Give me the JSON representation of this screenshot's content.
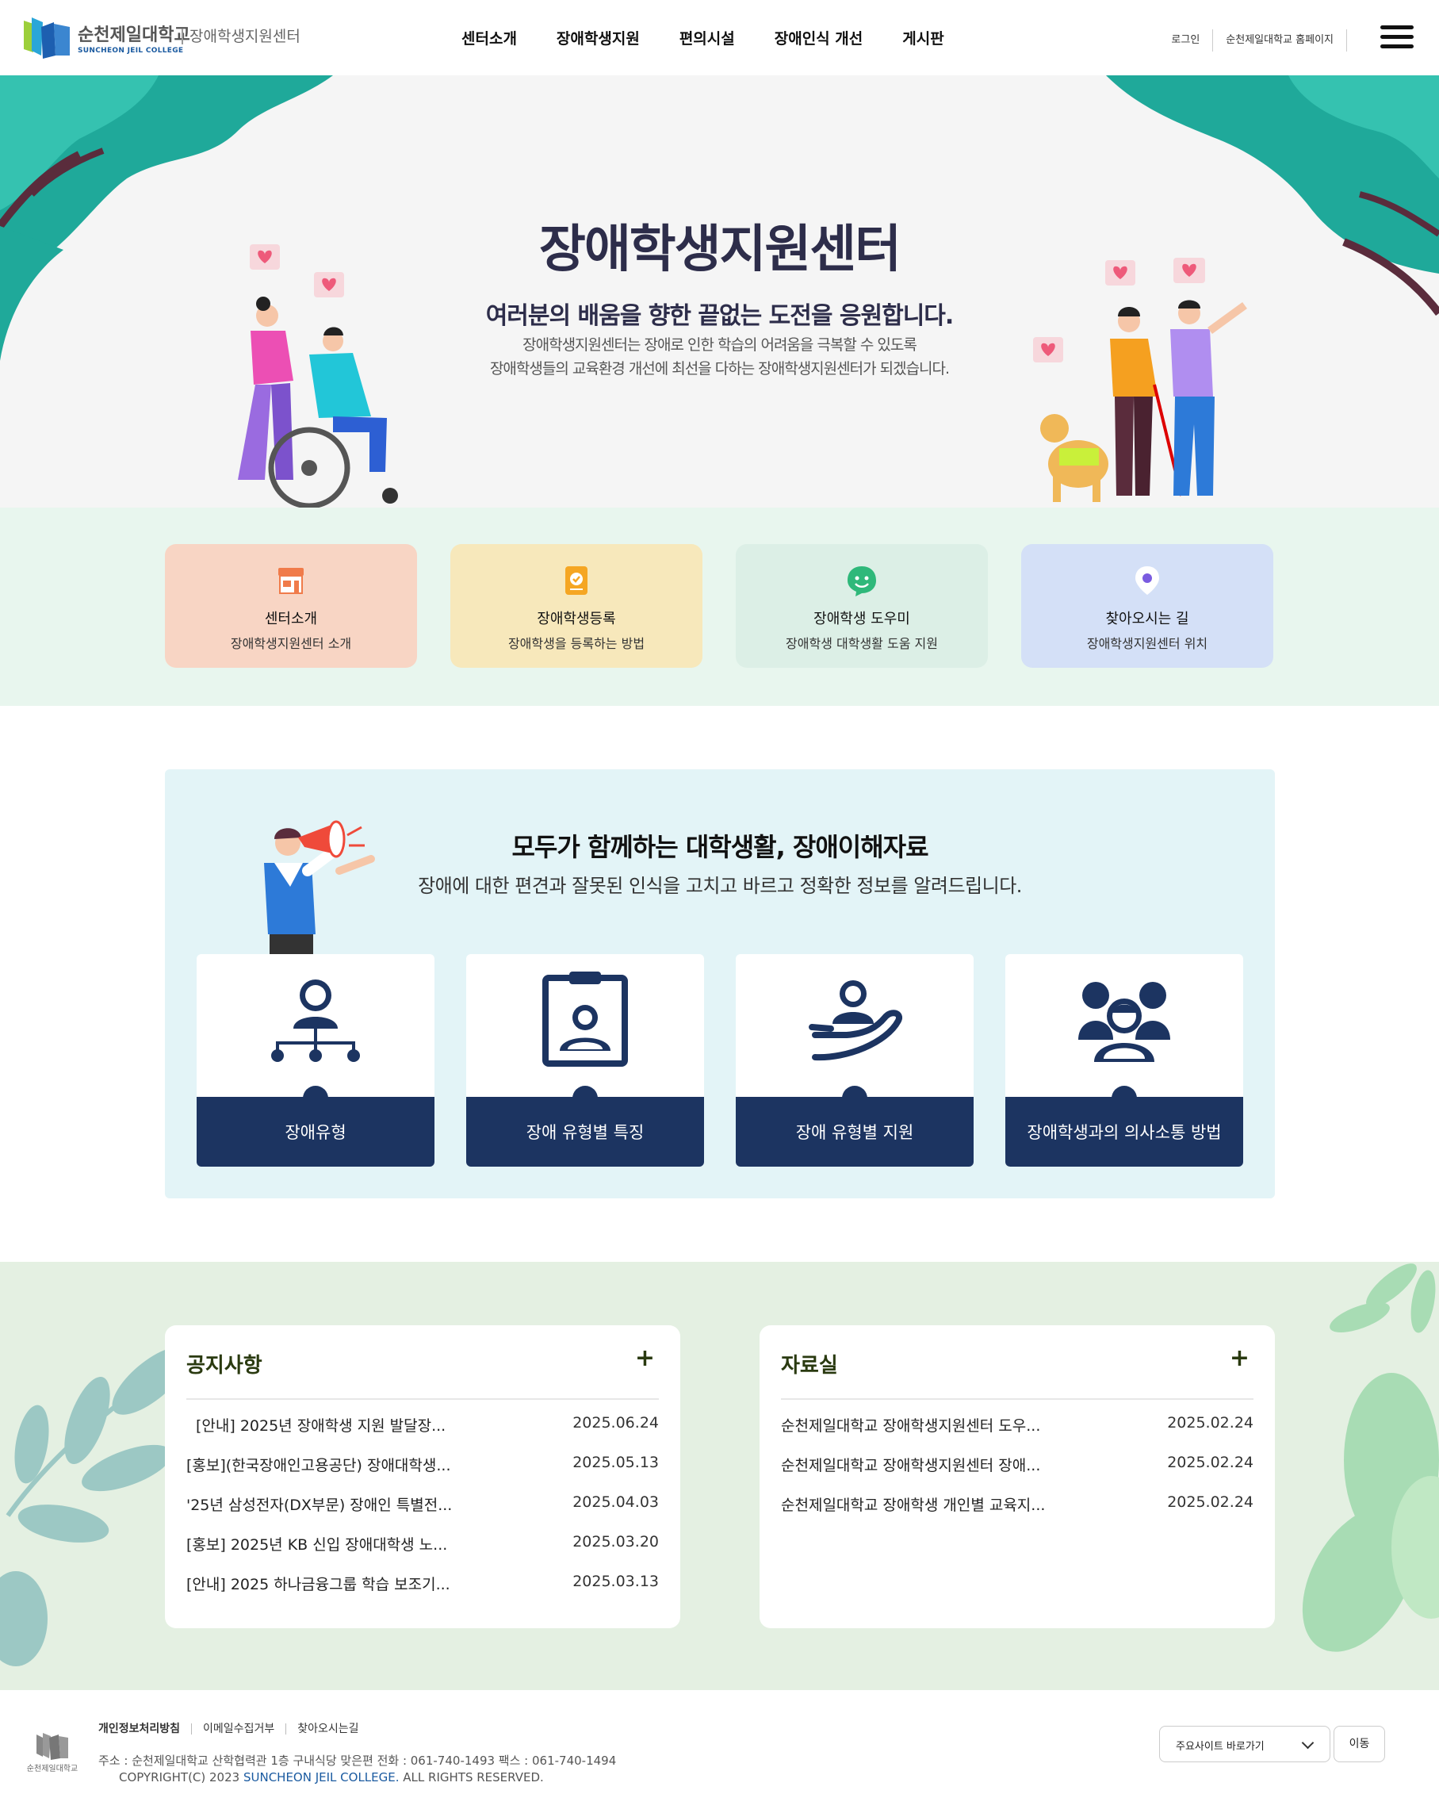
{
  "header": {
    "logo_name": "순천제일대학교",
    "logo_english": "SUNCHEON JEIL COLLEGE",
    "site_name": "장애학생지원센터",
    "nav": [
      "센터소개",
      "장애학생지원",
      "편의시설",
      "장애인식 개선",
      "게시판"
    ],
    "login": "로그인",
    "homepage": "순천제일대학교 홈페이지"
  },
  "hero": {
    "title": "장애학생지원센터",
    "subtitle": "여러분의 배움을 향한 끝없는 도전을 응원합니다.",
    "desc_line1": "장애학생지원센터는 장애로 인한 학습의 어려움을 극복할 수 있도록",
    "desc_line2": "장애학생들의 교육환경 개선에 최선을 다하는 장애학생지원센터가 되겠습니다."
  },
  "quick": [
    {
      "title": "센터소개",
      "desc": "장애학생지원센터 소개",
      "icon": "store-icon",
      "bg": "#f8d5c4"
    },
    {
      "title": "장애학생등록",
      "desc": "장애학생을 등록하는 방법",
      "icon": "notebook-check-icon",
      "bg": "#f7e8bb"
    },
    {
      "title": "장애학생 도우미",
      "desc": "장애학생 대학생활 도움 지원",
      "icon": "smile-chat-icon",
      "bg": "#dcefe6"
    },
    {
      "title": "찾아오시는 길",
      "desc": "장애학생지원센터 위치",
      "icon": "location-pin-icon",
      "bg": "#d4e0f7"
    }
  ],
  "awareness": {
    "title": "모두가 함께하는 대학생활, 장애이해자료",
    "desc": "장애에 대한 편견과 잘못된 인식을 고치고 바르고 정확한 정보를 알려드립니다.",
    "cards": [
      {
        "label": "장애유형",
        "icon": "org-chart-icon"
      },
      {
        "label": "장애 유형별 특징",
        "icon": "id-badge-icon"
      },
      {
        "label": "장애 유형별 지원",
        "icon": "hand-person-icon"
      },
      {
        "label": "장애학생과의 의사소통 방법",
        "icon": "group-icon"
      }
    ]
  },
  "notice": {
    "title": "공지사항",
    "more": "+",
    "items": [
      {
        "title": "[안내] 2025년 장애학생 지원 발달장...",
        "date": "2025.06.24"
      },
      {
        "title": "[홍보](한국장애인고용공단) 장애대학생...",
        "date": "2025.05.13"
      },
      {
        "title": "'25년 삼성전자(DX부문) 장애인 특별전...",
        "date": "2025.04.03"
      },
      {
        "title": "[홍보] 2025년 KB 신입 장애대학생 노...",
        "date": "2025.03.20"
      },
      {
        "title": "[안내] 2025 하나금융그룹 학습 보조기...",
        "date": "2025.03.13"
      }
    ]
  },
  "archive": {
    "title": "자료실",
    "more": "+",
    "items": [
      {
        "title": "순천제일대학교 장애학생지원센터 도우...",
        "date": "2025.02.24"
      },
      {
        "title": "순천제일대학교 장애학생지원센터 장애...",
        "date": "2025.02.24"
      },
      {
        "title": "순천제일대학교 장애학생 개인별 교육지...",
        "date": "2025.02.24"
      }
    ]
  },
  "footer": {
    "links": [
      "개인정보처리방침",
      "이메일수집거부",
      "찾아오시는길"
    ],
    "logo_name": "순천제일대학교",
    "address": "주소 : 순천제일대학교 산학협력관 1층 구내식당 맞은편 전화 : 061-740-1493 팩스 : 061-740-1494",
    "copy_prefix": "COPYRIGHT(C) 2023 ",
    "copy_brand": "SUNCHEON JEIL COLLEGE.",
    "copy_suffix": " ALL RIGHTS RESERVED.",
    "select_label": "주요사이트 바로가기",
    "go_button": "이동"
  },
  "colors": {
    "navy": "#1c3461",
    "title": "#2d2d4a",
    "teal_leaf": "#1fa99a",
    "quick_bg": "#e8f6ee",
    "aware_bg": "#e3f4f7",
    "board_bg": "#e4f0e2"
  }
}
